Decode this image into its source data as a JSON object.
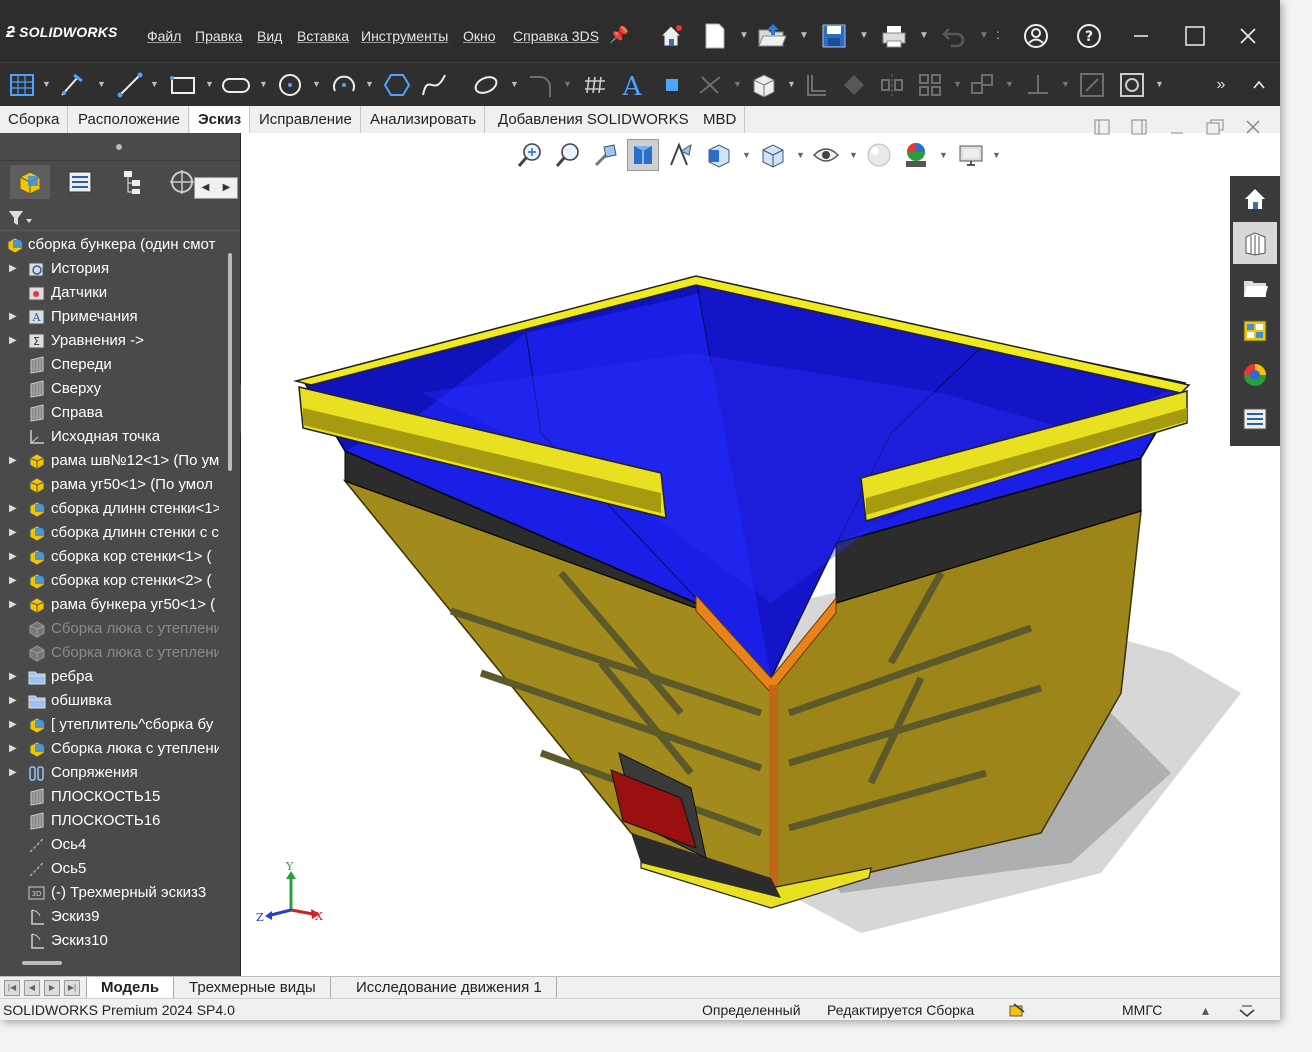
{
  "app": {
    "logo_text": "SOLIDWORKS",
    "menu": [
      "Файл",
      "Правка",
      "Вид",
      "Вставка",
      "Инструменты",
      "Окно",
      "Справка 3DS"
    ]
  },
  "tabs": [
    "Сборка",
    "Расположение",
    "Эскиз",
    "Исправление",
    "Анализировать",
    "Добавления SOLIDWORKS",
    "MBD"
  ],
  "active_tab": "Эскиз",
  "tree": {
    "root": "сборка бункера (один смот",
    "items": [
      {
        "label": "История",
        "expand": true,
        "icon": "history-icon"
      },
      {
        "label": "Датчики",
        "expand": false,
        "icon": "sensor-icon"
      },
      {
        "label": "Примечания",
        "expand": true,
        "icon": "annotations-icon"
      },
      {
        "label": "Уравнения ->",
        "expand": true,
        "icon": "equations-icon"
      },
      {
        "label": "Спереди",
        "expand": false,
        "icon": "plane-icon"
      },
      {
        "label": "Сверху",
        "expand": false,
        "icon": "plane-icon"
      },
      {
        "label": "Справа",
        "expand": false,
        "icon": "plane-icon"
      },
      {
        "label": "Исходная точка",
        "expand": false,
        "icon": "origin-icon"
      },
      {
        "label": "рама шв№12<1> (По ум",
        "expand": true,
        "icon": "part-icon"
      },
      {
        "label": "рама уг50<1> (По умол",
        "expand": false,
        "icon": "part-icon"
      },
      {
        "label": "сборка длинн стенки<1>",
        "expand": true,
        "icon": "assembly-icon"
      },
      {
        "label": "сборка длинн стенки с с",
        "expand": true,
        "icon": "assembly-icon"
      },
      {
        "label": "сборка кор стенки<1> (",
        "expand": true,
        "icon": "assembly-icon"
      },
      {
        "label": "сборка кор стенки<2> (",
        "expand": true,
        "icon": "assembly-icon"
      },
      {
        "label": "рама бункера уг50<1> (",
        "expand": true,
        "icon": "part-icon"
      },
      {
        "label": "Сборка люка с утеплени",
        "expand": false,
        "icon": "suppressed-icon",
        "dim": true
      },
      {
        "label": "Сборка люка с утеплени",
        "expand": false,
        "icon": "suppressed-icon",
        "dim": true
      },
      {
        "label": "ребра",
        "expand": true,
        "icon": "folder-icon"
      },
      {
        "label": "обшивка",
        "expand": true,
        "icon": "folder-icon"
      },
      {
        "label": "[ утеплитель^сборка бу",
        "expand": true,
        "icon": "assembly-icon"
      },
      {
        "label": "Сборка люка с утеплени",
        "expand": true,
        "icon": "assembly-icon"
      },
      {
        "label": "Сопряжения",
        "expand": true,
        "icon": "mates-icon"
      },
      {
        "label": "ПЛОСКОСТЬ15",
        "expand": false,
        "icon": "plane-icon"
      },
      {
        "label": "ПЛОСКОСТЬ16",
        "expand": false,
        "icon": "plane-icon"
      },
      {
        "label": "Ось4",
        "expand": false,
        "icon": "axis-icon"
      },
      {
        "label": "Ось5",
        "expand": false,
        "icon": "axis-icon"
      },
      {
        "label": "(-) Трехмерный эскиз3",
        "expand": false,
        "icon": "sketch3d-icon"
      },
      {
        "label": "Эскиз9",
        "expand": false,
        "icon": "sketch-icon"
      },
      {
        "label": "Эскиз10",
        "expand": false,
        "icon": "sketch-icon"
      }
    ]
  },
  "bottom_tabs": [
    "Модель",
    "Трехмерные виды",
    "Исследование движения 1"
  ],
  "status": {
    "product": "SOLIDWORKS Premium 2024 SP4.0",
    "state": "Определенный",
    "editing": "Редактируется Сборка",
    "units": "ММГС"
  },
  "triad": {
    "x": "X",
    "y": "Y",
    "z": "Z"
  },
  "colors": {
    "inner_blue": "#1a1ee6",
    "frame_yellow": "#e8e020",
    "wall_olive": "#a08a1c",
    "hatch_red": "#9a1010",
    "corner_orange": "#e88010"
  }
}
